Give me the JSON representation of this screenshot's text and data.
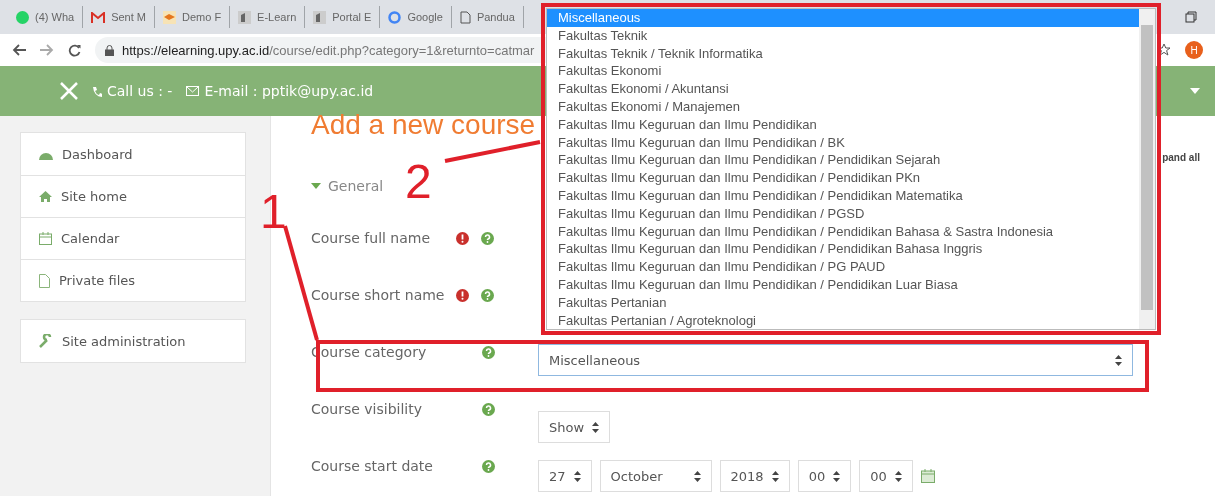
{
  "browser": {
    "tabs": [
      {
        "label": "(4) Wha",
        "kind": "chat"
      },
      {
        "label": "Sent M",
        "kind": "mail"
      },
      {
        "label": "Demo F",
        "kind": "app"
      },
      {
        "label": "E-Learn",
        "kind": "portal"
      },
      {
        "label": "Portal E",
        "kind": "portal"
      },
      {
        "label": "Google",
        "kind": "search"
      },
      {
        "label": "Pandua",
        "kind": "page"
      }
    ],
    "url_host": "https://elearning.upy.ac.id",
    "url_path": "/course/edit.php?category=1&returnto=catmar",
    "avatar": "H"
  },
  "navbar": {
    "phone": "Call us : -",
    "email": "E-mail : pptik@upy.ac.id"
  },
  "sidebar": {
    "groups": [
      [
        {
          "label": "Dashboard",
          "kind": "dashboard"
        },
        {
          "label": "Site home",
          "kind": "home"
        },
        {
          "label": "Calendar",
          "kind": "calendar"
        },
        {
          "label": "Private files",
          "kind": "file"
        }
      ],
      [
        {
          "label": "Site administration",
          "kind": "wrench"
        }
      ]
    ]
  },
  "page": {
    "title": "Add a new course",
    "expand_link": "pand all",
    "section": {
      "label": "General",
      "expanded": true
    },
    "fields": [
      {
        "kind": "text",
        "label": "Course full name",
        "required": true
      },
      {
        "kind": "text",
        "label": "Course short name",
        "required": true
      },
      {
        "kind": "select",
        "label": "Course category",
        "required": false,
        "value": "Miscellaneous"
      },
      {
        "kind": "select",
        "label": "Course visibility",
        "required": false,
        "value": "Show"
      },
      {
        "kind": "date",
        "label": "Course start date",
        "required": false,
        "parts": [
          "27",
          "October",
          "2018",
          "00",
          "00"
        ]
      }
    ]
  },
  "dropdown": {
    "options": [
      {
        "label": "Miscellaneous",
        "selected": true
      },
      {
        "label": "Fakultas Teknik",
        "selected": false
      },
      {
        "label": "Fakultas Teknik / Teknik Informatika",
        "selected": false
      },
      {
        "label": "Fakultas Ekonomi",
        "selected": false
      },
      {
        "label": "Fakultas Ekonomi / Akuntansi",
        "selected": false
      },
      {
        "label": "Fakultas Ekonomi / Manajemen",
        "selected": false
      },
      {
        "label": "Fakultas Ilmu Keguruan dan Ilmu Pendidikan",
        "selected": false
      },
      {
        "label": "Fakultas Ilmu Keguruan dan Ilmu Pendidikan / BK",
        "selected": false
      },
      {
        "label": "Fakultas Ilmu Keguruan dan Ilmu Pendidikan / Pendidikan Sejarah",
        "selected": false
      },
      {
        "label": "Fakultas Ilmu Keguruan dan Ilmu Pendidikan / Pendidikan PKn",
        "selected": false
      },
      {
        "label": "Fakultas Ilmu Keguruan dan Ilmu Pendidikan / Pendidikan Matematika",
        "selected": false
      },
      {
        "label": "Fakultas Ilmu Keguruan dan Ilmu Pendidikan / PGSD",
        "selected": false
      },
      {
        "label": "Fakultas Ilmu Keguruan dan Ilmu Pendidikan / Pendidikan Bahasa & Sastra Indonesia",
        "selected": false
      },
      {
        "label": "Fakultas Ilmu Keguruan dan Ilmu Pendidikan / Pendidikan Bahasa Inggris",
        "selected": false
      },
      {
        "label": "Fakultas Ilmu Keguruan dan Ilmu Pendidikan / PG PAUD",
        "selected": false
      },
      {
        "label": "Fakultas Ilmu Keguruan dan Ilmu Pendidikan / Pendidikan Luar Biasa",
        "selected": false
      },
      {
        "label": "Fakultas Pertanian",
        "selected": false
      },
      {
        "label": "Fakultas Pertanian / Agroteknologi",
        "selected": false
      }
    ]
  },
  "annotations": [
    {
      "label": "1"
    },
    {
      "label": "2"
    }
  ]
}
